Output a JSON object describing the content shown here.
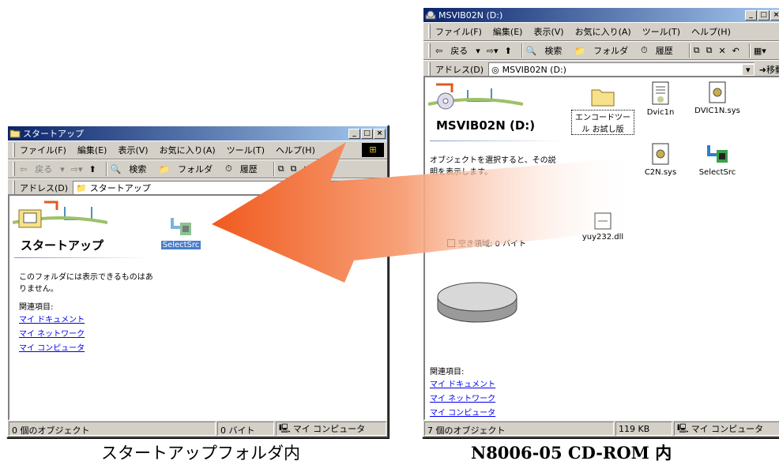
{
  "left_window": {
    "title": "スタートアップ",
    "menu": [
      "ファイル(F)",
      "編集(E)",
      "表示(V)",
      "お気に入り(A)",
      "ツール(T)",
      "ヘルプ(H)"
    ],
    "toolbar": {
      "back": "戻る",
      "search": "検索",
      "folders": "フォルダ",
      "history": "履歴"
    },
    "address_label": "アドレス(D)",
    "address_value": "スタートアップ",
    "folder_title": "スタートアップ",
    "empty_message": "このフォルダには表示できるものはありません。",
    "related_heading": "関連項目:",
    "links": [
      "マイ ドキュメント",
      "マイ ネットワーク",
      "マイ コンピュータ"
    ],
    "file": "SelectSrc",
    "status": {
      "objects": "0 個のオブジェクト",
      "size": "0 バイト",
      "location": "マイ コンピュータ"
    }
  },
  "right_window": {
    "title": "MSVIB02N (D:)",
    "menu": [
      "ファイル(F)",
      "編集(E)",
      "表示(V)",
      "お気に入り(A)",
      "ツール(T)",
      "ヘルプ(H)"
    ],
    "toolbar": {
      "back": "戻る",
      "search": "検索",
      "folders": "フォルダ",
      "history": "履歴"
    },
    "address_label": "アドレス(D)",
    "address_value": "MSVIB02N (D:)",
    "go": "移動",
    "folder_title": "MSVIB02N (D:)",
    "select_hint": "オブジェクトを選択すると、その説明を表示します。",
    "free_space": "空き領域: 0 バイト",
    "related_heading": "関連項目:",
    "links": [
      "マイ ドキュメント",
      "マイ ネットワーク",
      "マイ コンピュータ"
    ],
    "files": [
      "エンコードツール お試し版",
      "Dvic1n",
      "DVIC1N.sys",
      "C2N.sys",
      "SelectSrc",
      "yuy232.dll"
    ],
    "status": {
      "objects": "7 個のオブジェクト",
      "size": "119 KB",
      "location": "マイ コンピュータ"
    }
  },
  "captions": {
    "left": "スタートアップフォルダ内",
    "right": "N8006-05 CD-ROM 内"
  },
  "colors": {
    "titlebar": "#0a246a",
    "arrow": "#f05a1e",
    "link": "#0000ee"
  }
}
